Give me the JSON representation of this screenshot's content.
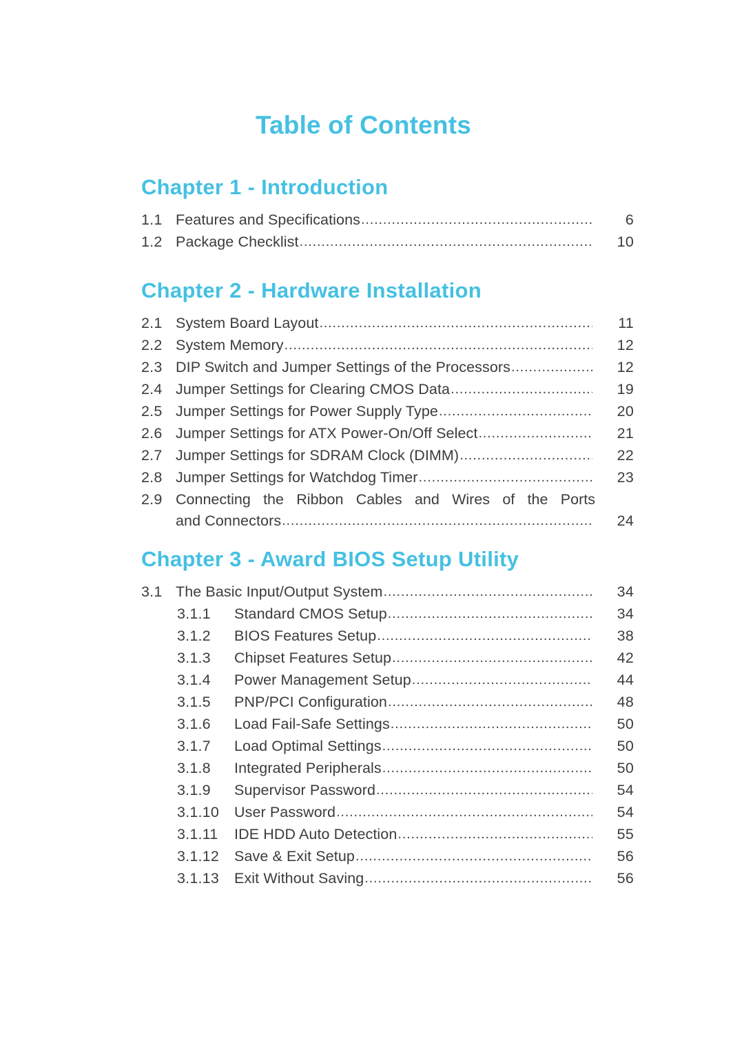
{
  "document": {
    "title": "Table of Contents",
    "accent_color": "#45c0e2",
    "text_color": "#3d3b3c"
  },
  "chapters": [
    {
      "heading": "Chapter  1 - Introduction",
      "entries": [
        {
          "num": "1.1",
          "label": "Features and Specifications",
          "page": "6",
          "level": 1
        },
        {
          "num": "1.2",
          "label": "Package Checklist",
          "page": "10",
          "level": 1
        }
      ]
    },
    {
      "heading": "Chapter  2 - Hardware Installation",
      "entries": [
        {
          "num": "2.1",
          "label": "System Board Layout ",
          "page": "11",
          "level": 1
        },
        {
          "num": "2.2",
          "label": "System Memory",
          "page": "12",
          "level": 1
        },
        {
          "num": "2.3",
          "label": "DIP Switch and Jumper Settings of the Processors",
          "page": "12",
          "level": 1
        },
        {
          "num": "2.4",
          "label": "Jumper Settings for Clearing CMOS Data",
          "page": "19",
          "level": 1
        },
        {
          "num": "2.5",
          "label": "Jumper Settings for Power Supply Type",
          "page": "20",
          "level": 1
        },
        {
          "num": "2.6",
          "label": "Jumper Settings for ATX Power-On/Off Select",
          "page": "21",
          "level": 1
        },
        {
          "num": "2.7",
          "label": "Jumper Settings for SDRAM Clock (DIMM)",
          "page": "22",
          "level": 1
        },
        {
          "num": "2.8",
          "label": "Jumper Settings for Watchdog Timer",
          "page": "23",
          "level": 1
        },
        {
          "num": "2.9",
          "label": "Connecting the Ribbon Cables and Wires of the Ports and Connectors",
          "line1_words": [
            "Connecting",
            "the",
            "Ribbon",
            "Cables",
            "and",
            "Wires",
            "of",
            "the",
            "Ports"
          ],
          "line2": "and Connectors",
          "page": "24",
          "level": 1,
          "wrapped": true
        }
      ]
    },
    {
      "heading": "Chapter  3 - Award BIOS Setup Utility",
      "entries": [
        {
          "num": "3.1",
          "label": "The Basic Input/Output System",
          "page": "34",
          "level": 1
        },
        {
          "num": "3.1.1",
          "label": "Standard CMOS Setup",
          "page": "34",
          "level": 2
        },
        {
          "num": "3.1.2",
          "label": "BIOS Features Setup",
          "page": "38",
          "level": 2
        },
        {
          "num": "3.1.3",
          "label": "Chipset Features Setup",
          "page": "42",
          "level": 2
        },
        {
          "num": "3.1.4",
          "label": "Power Management Setup",
          "page": "44",
          "level": 2
        },
        {
          "num": "3.1.5",
          "label": "PNP/PCI Configuration",
          "page": "48",
          "level": 2
        },
        {
          "num": "3.1.6",
          "label": "Load Fail-Safe Settings",
          "page": "50",
          "level": 2
        },
        {
          "num": "3.1.7",
          "label": "Load Optimal Settings",
          "page": "50",
          "level": 2
        },
        {
          "num": "3.1.8",
          "label": "Integrated Peripherals",
          "page": "50",
          "level": 2
        },
        {
          "num": "3.1.9",
          "label": "Supervisor Password",
          "page": "54",
          "level": 2
        },
        {
          "num": "3.1.10",
          "label": "User Password",
          "page": "54",
          "level": 2
        },
        {
          "num": "3.1.11",
          "label": "IDE HDD Auto Detection",
          "page": "55",
          "level": 2
        },
        {
          "num": "3.1.12",
          "label": "Save & Exit Setup",
          "page": "56",
          "level": 2
        },
        {
          "num": "3.1.13",
          "label": "Exit Without Saving",
          "page": "56",
          "level": 2
        }
      ]
    }
  ]
}
